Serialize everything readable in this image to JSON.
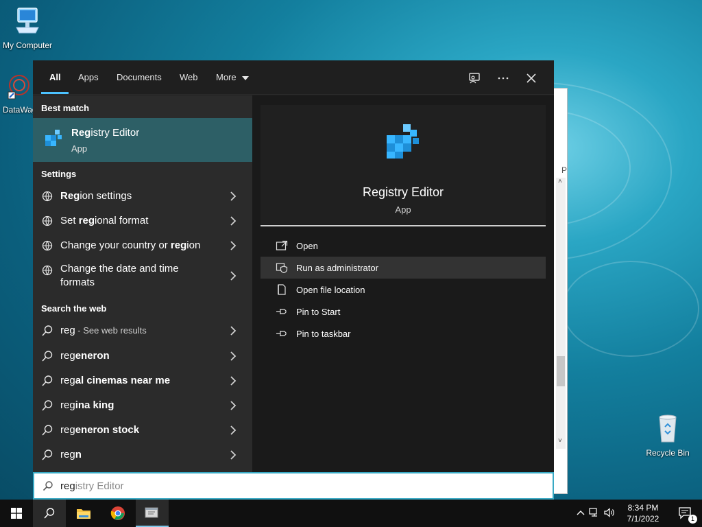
{
  "desktop": {
    "icons": [
      {
        "label": "My Computer"
      },
      {
        "label": "DataWag"
      },
      {
        "label": "Recycle Bin"
      }
    ]
  },
  "background_window": {
    "letter": "P"
  },
  "search": {
    "tabs": [
      {
        "label": "All",
        "active": true
      },
      {
        "label": "Apps"
      },
      {
        "label": "Documents"
      },
      {
        "label": "Web"
      },
      {
        "label": "More"
      }
    ],
    "sections": {
      "best_match": "Best match",
      "settings": "Settings",
      "search_web": "Search the web"
    },
    "best_match": {
      "title_bold": "Reg",
      "title_rest": "istry Editor",
      "subtitle": "App"
    },
    "settings_items": [
      {
        "bold": "Reg",
        "rest": "ion settings",
        "pre": ""
      },
      {
        "pre": "Set ",
        "bold": "reg",
        "rest": "ional format"
      },
      {
        "pre": "Change your country or ",
        "bold": "reg",
        "rest": "ion"
      },
      {
        "pre": "",
        "bold": "",
        "rest": "Change the date and time",
        "line2": "formats"
      }
    ],
    "web_items": [
      {
        "pre": "reg",
        "bold": "",
        "rest": "",
        "suffix": " - See web results"
      },
      {
        "pre": "reg",
        "bold": "eneron",
        "rest": ""
      },
      {
        "pre": "reg",
        "bold": "al cinemas near me",
        "rest": ""
      },
      {
        "pre": "reg",
        "bold": "ina king",
        "rest": ""
      },
      {
        "pre": "reg",
        "bold": "eneron stock",
        "rest": ""
      },
      {
        "pre": "reg",
        "bold": "n",
        "rest": ""
      }
    ],
    "preview": {
      "title": "Registry Editor",
      "subtitle": "App"
    },
    "actions": [
      {
        "label": "Open"
      },
      {
        "label": "Run as administrator"
      },
      {
        "label": "Open file location"
      },
      {
        "label": "Pin to Start"
      },
      {
        "label": "Pin to taskbar"
      }
    ],
    "query": {
      "typed": "reg",
      "ghost": "istry Editor"
    }
  },
  "taskbar": {
    "clock_time": "8:34 PM",
    "clock_date": "7/1/2022",
    "notification_count": "1"
  },
  "colors": {
    "accent": "#4cc2ff",
    "best_match_bg": "#2d5f66",
    "panel_bg": "#1f1f1f"
  }
}
